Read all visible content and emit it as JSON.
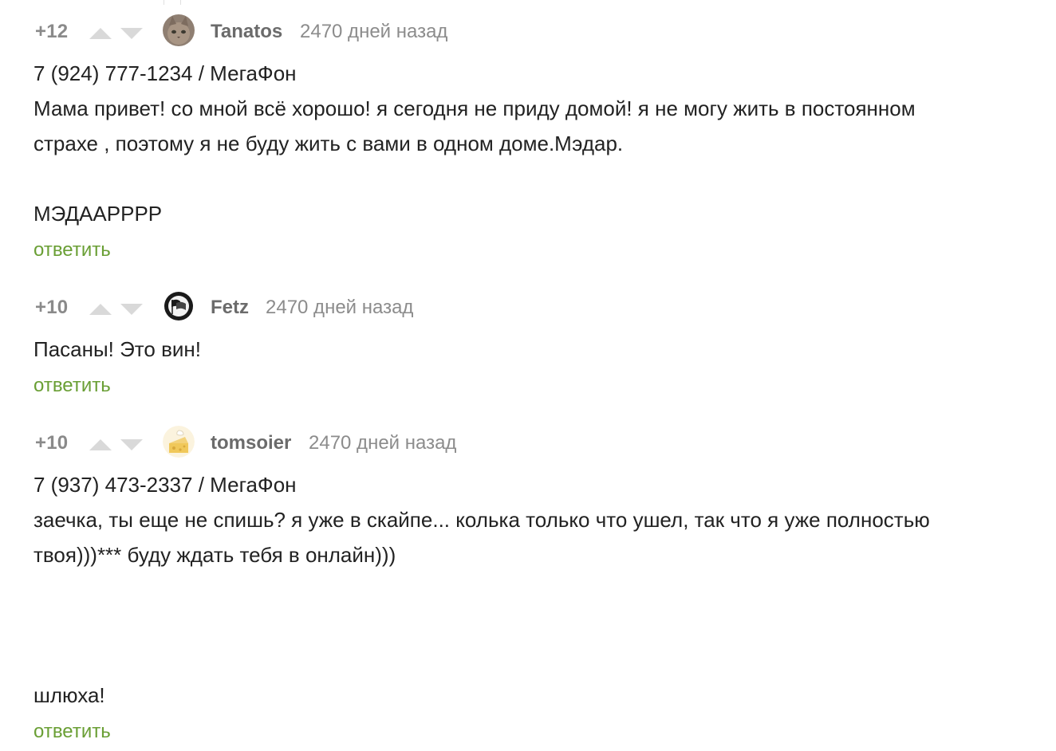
{
  "comments": [
    {
      "rating": "+12",
      "author": "Tanatos",
      "time": "2470 дней назад",
      "avatar_icon": "cat-avatar-icon",
      "lines": [
        "7 (924) 777-1234 / МегаФон",
        "Мама привет! со мной всё хорошо! я сегодня не приду домой! я не могу жить в постоянном",
        "страхе , поэтому я не буду жить с вами в одном доме.Мэдар.",
        "МЭДААРРРР"
      ],
      "reply": "ответить"
    },
    {
      "rating": "+10",
      "author": "Fetz",
      "time": "2470 дней назад",
      "avatar_icon": "antifa-flag-avatar-icon",
      "lines": [
        "Пасаны! Это вин!"
      ],
      "reply": "ответить"
    },
    {
      "rating": "+10",
      "author": "tomsoier",
      "time": "2470 дней назад",
      "avatar_icon": "cheese-avatar-icon",
      "lines": [
        "7 (937) 473-2337 / МегаФон",
        "заечка, ты еще не спишь? я уже в скайпе... колька только что ушел, так что я уже полностью",
        "твоя)))*** буду ждать тебя в онлайн)))",
        "шлюха!"
      ],
      "reply": "ответить"
    }
  ],
  "colors": {
    "reply": "#6a9f35",
    "author": "#6b6b6b",
    "meta": "#8c8c8c",
    "vote_arrow": "#d9d9d9",
    "text": "#222222"
  }
}
